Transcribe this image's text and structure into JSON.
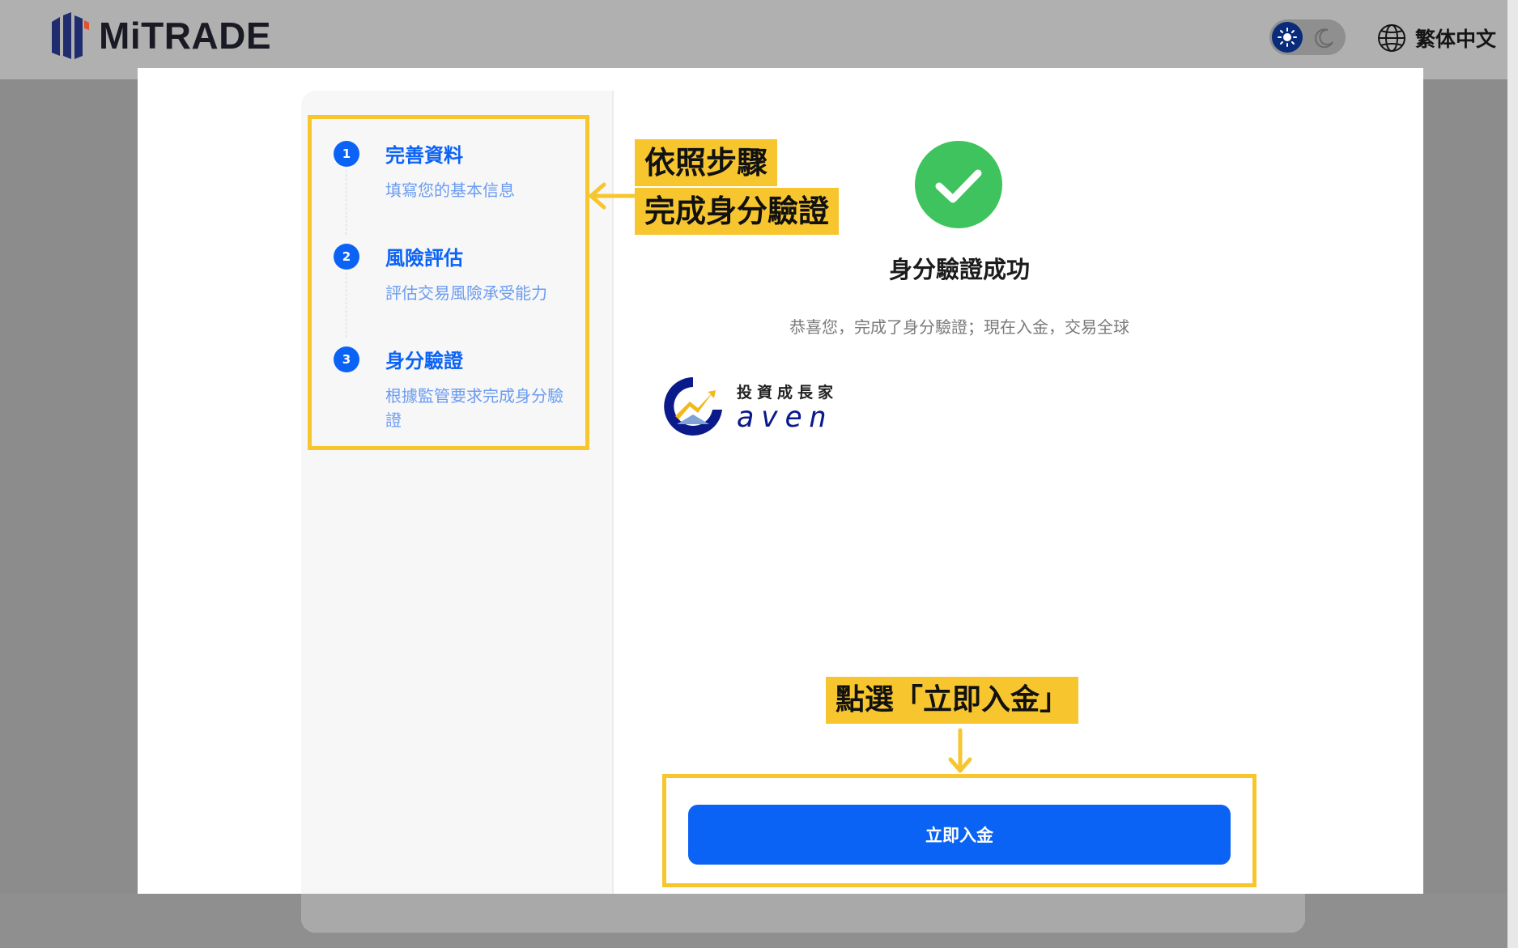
{
  "header": {
    "logo_text": "MiTRADE",
    "theme_toggle": {
      "mode": "light"
    },
    "language": "繁体中文"
  },
  "steps": [
    {
      "number": "1",
      "title": "完善資料",
      "description": "填寫您的基本信息"
    },
    {
      "number": "2",
      "title": "風險評估",
      "description": "評估交易風險承受能力"
    },
    {
      "number": "3",
      "title": "身分驗證",
      "description": "根據監管要求完成身分驗證"
    }
  ],
  "annotations": {
    "steps_note_line1": "依照步驟",
    "steps_note_line2": "完成身分驗證",
    "button_note": "點選「立即入金」",
    "highlight_color": "#f7c62f"
  },
  "result": {
    "title": "身分驗證成功",
    "description": "恭喜您，完成了身分驗證；現在入金，交易全球",
    "status_color": "#3fc35e"
  },
  "watermark": {
    "chinese": "投資成長家",
    "english": "aven"
  },
  "actions": {
    "deposit_label": "立即入金",
    "accent_color": "#0b63f6"
  }
}
